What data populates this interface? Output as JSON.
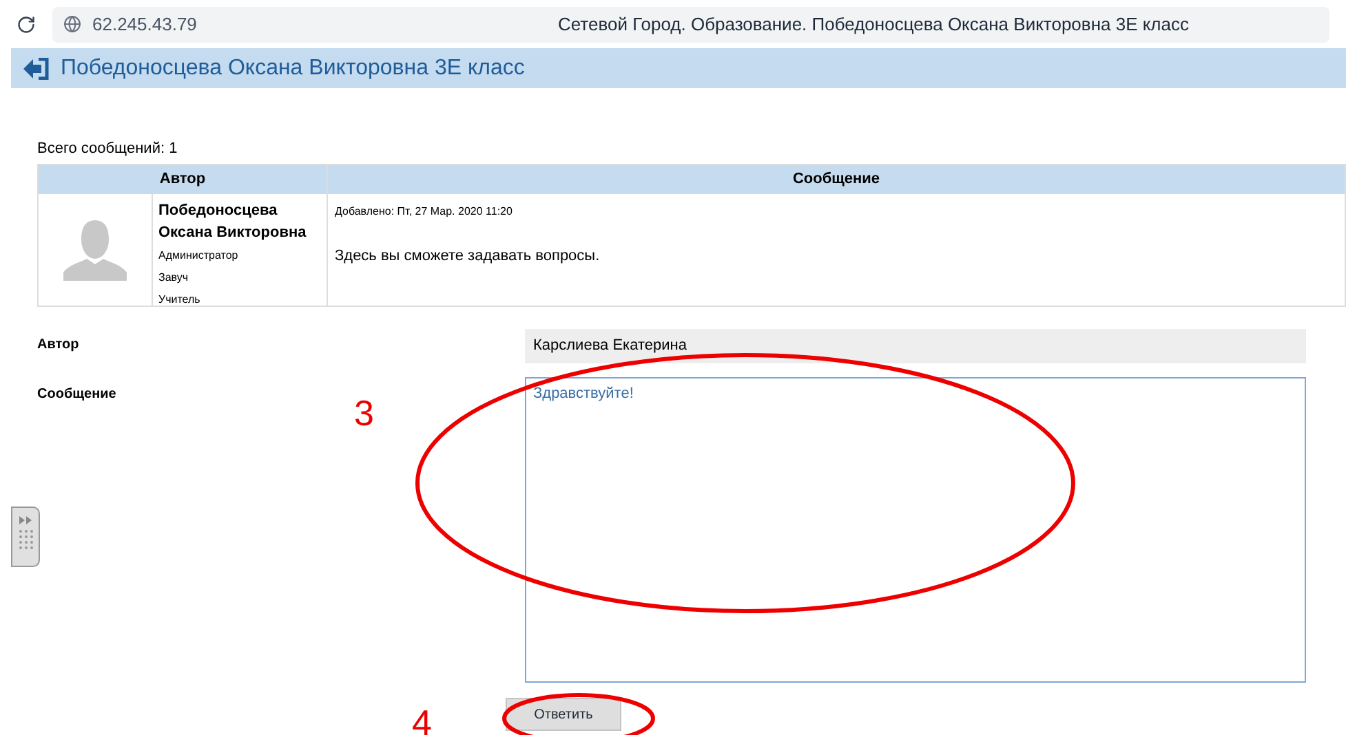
{
  "browser": {
    "address": "62.245.43.79",
    "title": "Сетевой Город. Образование. Победоносцева Оксана Викторовна 3Е класс"
  },
  "header": {
    "title": "Победоносцева Оксана Викторовна 3Е класс"
  },
  "total": "Всего сообщений: 1",
  "table": {
    "columns": [
      "Автор",
      "Сообщение"
    ],
    "rows": [
      {
        "name": "Победоносцева Оксана Викторовна",
        "roles": [
          "Администратор",
          "Завуч",
          "Учитель"
        ],
        "added": "Добавлено: Пт, 27 Мар. 2020 11:20",
        "message": "Здесь вы сможете задавать вопросы."
      }
    ]
  },
  "form": {
    "author_label": "Автор",
    "author_value": "Карслиева Екатерина",
    "message_label": "Сообщение",
    "message_value": "Здравствуйте!",
    "submit": "Ответить"
  },
  "annotations": [
    {
      "label": "3"
    },
    {
      "label": "4"
    }
  ]
}
